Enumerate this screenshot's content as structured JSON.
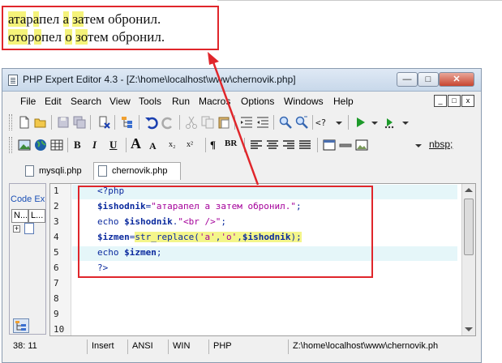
{
  "output": {
    "line1_hl1": "ата",
    "line1_a": "р",
    "line1_hl2": "а",
    "line1_b": "пел ",
    "line1_hl3": "а",
    "line1_c": " ",
    "line1_hl4": "за",
    "line1_d": "тем обронил.",
    "line2_hl1": "ото",
    "line2_a": "р",
    "line2_hl2": "о",
    "line2_b": "пел ",
    "line2_hl3": "о",
    "line2_c": " ",
    "line2_hl4": "зо",
    "line2_d": "тем обронил."
  },
  "window": {
    "title": "PHP Expert Editor 4.3 - [Z:\\home\\localhost\\www\\chernovik.php]",
    "min_label": "—",
    "max_label": "□",
    "close_label": "✕"
  },
  "menu": {
    "items": [
      "File",
      "Edit",
      "Search",
      "View",
      "Tools",
      "Run",
      "Macros",
      "Options",
      "Windows",
      "Help"
    ],
    "mdi": [
      "_",
      "□",
      "x"
    ]
  },
  "toolbar2": {
    "bold": "B",
    "italic": "I",
    "underline": "U",
    "font_big": "A",
    "sub": "x₂",
    "sup": "x²",
    "para": "¶",
    "br": "BR",
    "nbsp": "nbsp;"
  },
  "tabs": [
    "mysqli.php",
    "chernovik.php"
  ],
  "sidebar": {
    "title": "Code Explorer",
    "tab1": "N...",
    "tab2": "L..."
  },
  "editor": {
    "line_numbers": [
      "1",
      "2",
      "3",
      "4",
      "5",
      "6",
      "7",
      "8",
      "9",
      "10"
    ],
    "code": {
      "l1": "<?php",
      "l2_var": "$ishodnik",
      "l2_eq": "=",
      "l2_str": "\"атарапел а затем обронил.\"",
      "l2_end": ";",
      "l3_kw": "echo ",
      "l3_var": "$ishodnik",
      "l3_dot": ".",
      "l3_str": "\"<br />\"",
      "l3_end": ";",
      "l4_var": "$izmen",
      "l4_eq": "=",
      "l4_fn": "str_replace(",
      "l4_a1": "'а'",
      "l4_c1": ",",
      "l4_a2": "'о'",
      "l4_c2": ",",
      "l4_var2": "$ishodnik",
      "l4_end": ");",
      "l5_kw": "echo ",
      "l5_var": "$izmen",
      "l5_end": ";",
      "l6": "?>"
    }
  },
  "status": {
    "pos": "38: 11",
    "mode": "Insert",
    "enc": "ANSI",
    "eol": "WIN",
    "lang": "PHP",
    "path": "Z:\\home\\localhost\\www\\chernovik.ph"
  },
  "colors": {
    "annotation_red": "#e0262b",
    "highlight_yellow": "#f5f37a"
  }
}
